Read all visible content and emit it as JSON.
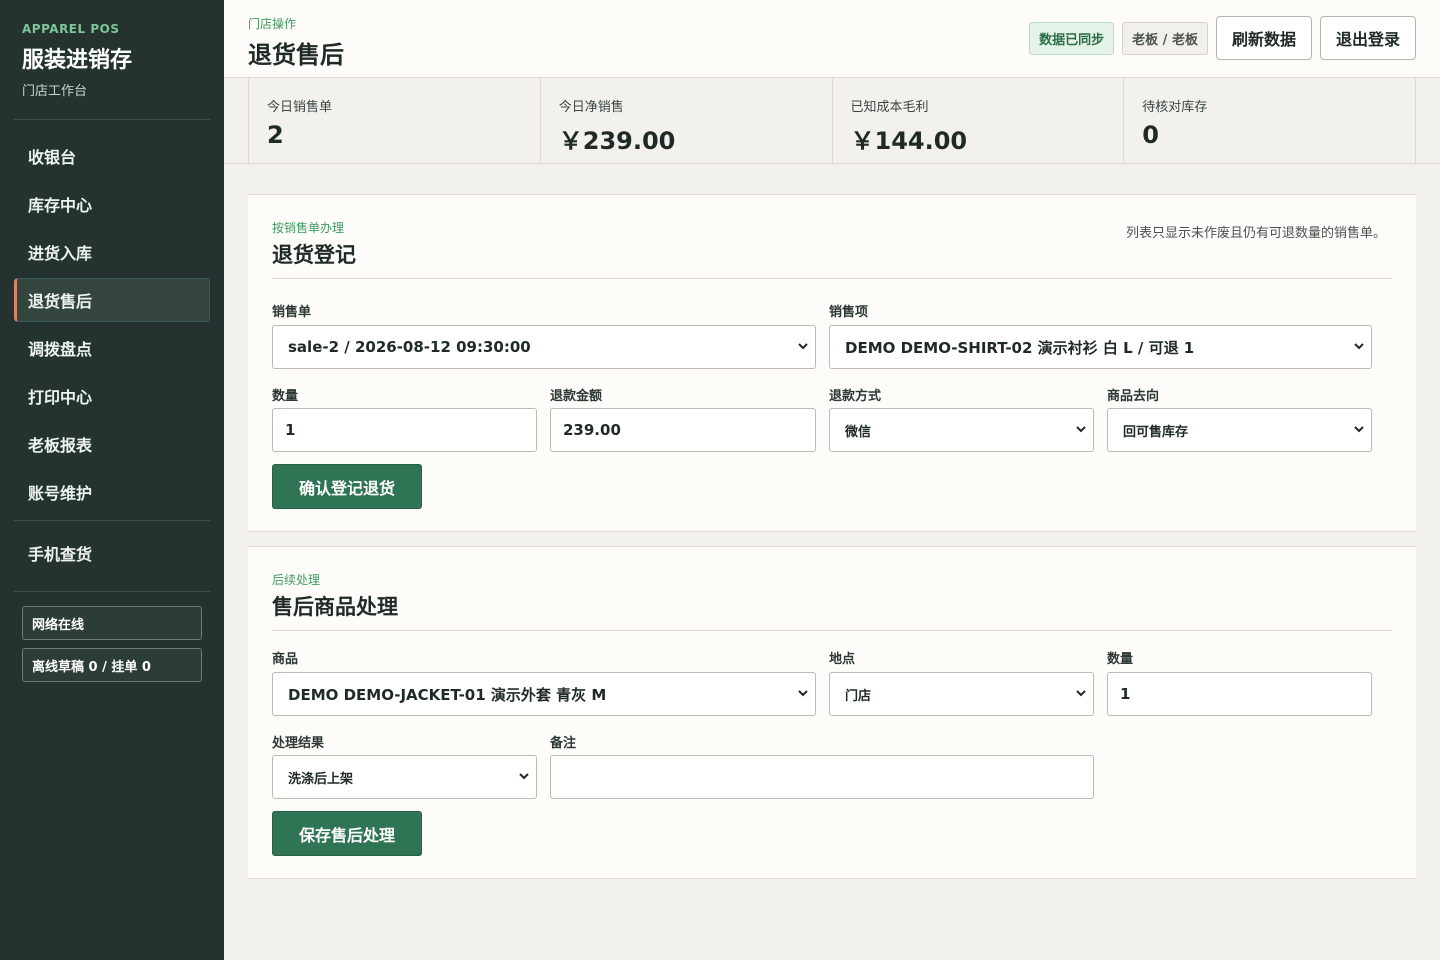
{
  "sidebar": {
    "brand_kicker": "APPAREL POS",
    "brand_title": "服装进销存",
    "brand_sub": "门店工作台",
    "nav": [
      {
        "label": "收银台",
        "active": false
      },
      {
        "label": "库存中心",
        "active": false
      },
      {
        "label": "进货入库",
        "active": false
      },
      {
        "label": "退货售后",
        "active": true
      },
      {
        "label": "调拨盘点",
        "active": false
      },
      {
        "label": "打印中心",
        "active": false
      },
      {
        "label": "老板报表",
        "active": false
      },
      {
        "label": "账号维护",
        "active": false
      }
    ],
    "mobile_lookup": "手机查货",
    "network_status": "网络在线",
    "offline_status": "离线草稿 0 / 挂单 0"
  },
  "header": {
    "kicker": "门店操作",
    "title": "退货售后",
    "sync_badge": "数据已同步",
    "user_badge": "老板 / 老板",
    "refresh_label": "刷新数据",
    "logout_label": "退出登录"
  },
  "stats": [
    {
      "label": "今日销售单",
      "value": "2"
    },
    {
      "label": "今日净销售",
      "value": "￥239.00"
    },
    {
      "label": "已知成本毛利",
      "value": "￥144.00"
    },
    {
      "label": "待核对库存",
      "value": "0"
    }
  ],
  "returns": {
    "kicker": "按销售单办理",
    "title": "退货登记",
    "note": "列表只显示未作废且仍有可退数量的销售单。",
    "sale_label": "销售单",
    "sale_value": "sale-2 / 2026-08-12 09:30:00",
    "item_label": "销售项",
    "item_value": "DEMO DEMO-SHIRT-02 演示衬衫 白 L / 可退 1",
    "qty_label": "数量",
    "qty_value": "1",
    "amount_label": "退款金额",
    "amount_value": "239.00",
    "method_label": "退款方式",
    "method_value": "微信",
    "dest_label": "商品去向",
    "dest_value": "回可售库存",
    "submit_label": "确认登记退货"
  },
  "aftersale": {
    "kicker": "后续处理",
    "title": "售后商品处理",
    "product_label": "商品",
    "product_value": "DEMO DEMO-JACKET-01 演示外套 青灰 M",
    "location_label": "地点",
    "location_value": "门店",
    "qty_label": "数量",
    "qty_value": "1",
    "result_label": "处理结果",
    "result_value": "洗涤后上架",
    "remark_label": "备注",
    "remark_value": "",
    "submit_label": "保存售后处理"
  }
}
